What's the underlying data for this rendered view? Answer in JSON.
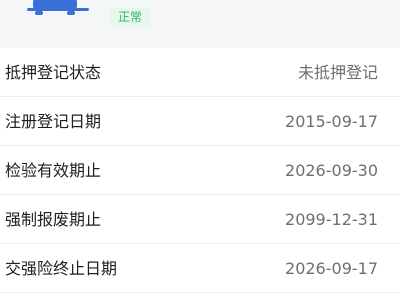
{
  "header": {
    "vehicle_icon": "vehicle-icon",
    "status_badge": "正常",
    "colors": {
      "accent_blue": "#3a6fd8",
      "badge_bg": "#e6f7ec",
      "badge_text": "#2fb36b"
    }
  },
  "info": {
    "rows": [
      {
        "label": "抵押登记状态",
        "value": "未抵押登记"
      },
      {
        "label": "注册登记日期",
        "value": "2015-09-17"
      },
      {
        "label": "检验有效期止",
        "value": "2026-09-30"
      },
      {
        "label": "强制报废期止",
        "value": "2099-12-31"
      },
      {
        "label": "交强险终止日期",
        "value": "2026-09-17"
      }
    ]
  }
}
